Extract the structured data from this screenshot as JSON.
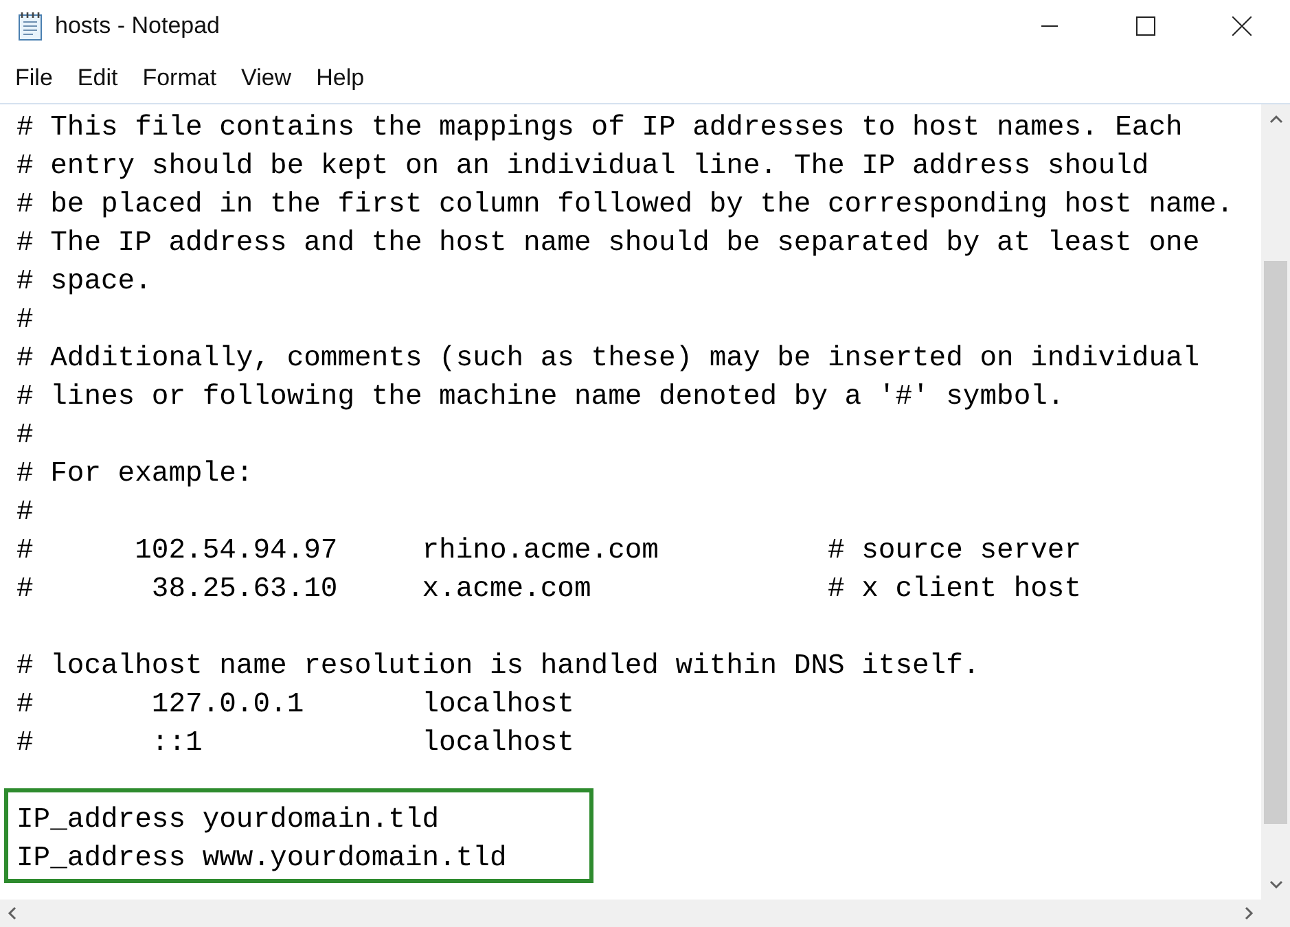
{
  "window": {
    "title": "hosts - Notepad"
  },
  "menu": [
    "File",
    "Edit",
    "Format",
    "View",
    "Help"
  ],
  "blocks": [
    {
      "highlighted": false,
      "lines": [
        "# This file contains the mappings of IP addresses to host names. Each",
        "# entry should be kept on an individual line. The IP address should",
        "# be placed in the first column followed by the corresponding host name.",
        "# The IP address and the host name should be separated by at least one",
        "# space.",
        "#",
        "# Additionally, comments (such as these) may be inserted on individual",
        "# lines or following the machine name denoted by a '#' symbol.",
        "#",
        "# For example:",
        "#",
        "#      102.54.94.97     rhino.acme.com          # source server",
        "#       38.25.63.10     x.acme.com              # x client host"
      ]
    },
    {
      "highlighted": false,
      "lines": [
        "# localhost name resolution is handled within DNS itself.",
        "#       127.0.0.1       localhost",
        "#       ::1             localhost"
      ]
    },
    {
      "highlighted": true,
      "lines": [
        "IP_address yourdomain.tld",
        "IP_address www.yourdomain.tld"
      ]
    }
  ]
}
